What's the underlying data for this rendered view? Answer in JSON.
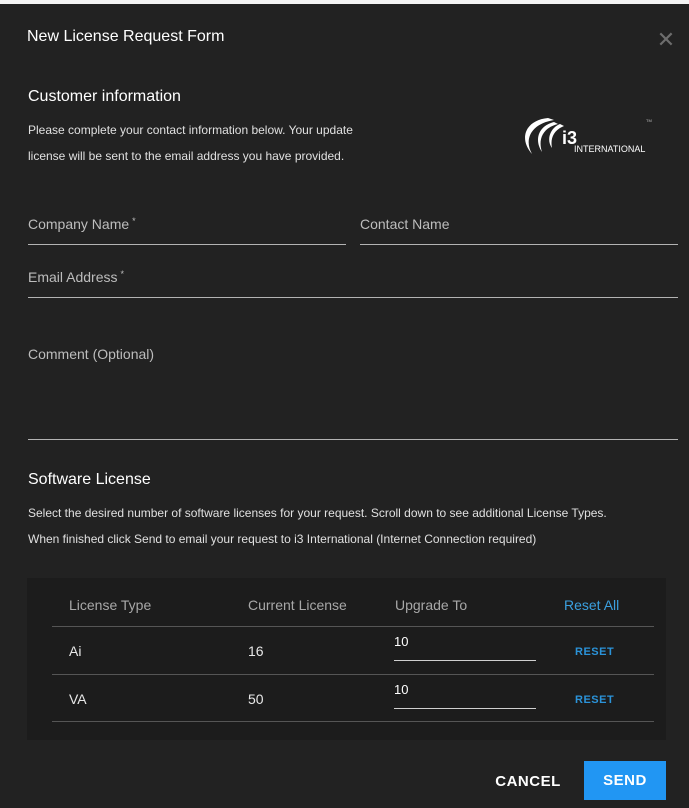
{
  "dialog": {
    "title": "New License Request Form",
    "close_icon": "close-icon"
  },
  "customer": {
    "heading": "Customer information",
    "desc_line1": "Please complete your contact information below. Your update",
    "desc_line2": "license will be sent to the email address you have provided.",
    "logo": {
      "mark": "i3",
      "text": "INTERNATIONAL",
      "tm": "TM"
    },
    "fields": {
      "company": {
        "label": "Company Name",
        "required": "*",
        "value": ""
      },
      "contact": {
        "label": "Contact Name",
        "value": ""
      },
      "email": {
        "label": "Email Address",
        "required": "*",
        "value": ""
      },
      "comment": {
        "label": "Comment (Optional)",
        "value": ""
      }
    }
  },
  "software": {
    "heading": "Software License",
    "desc_line1": "Select the desired number of software licenses for your request. Scroll down to see additional License Types.",
    "desc_line2": "When finished click Send to email your request to i3 International (Internet Connection required)",
    "table": {
      "headers": {
        "type": "License Type",
        "current": "Current License",
        "upgrade": "Upgrade To",
        "reset_all": "Reset All"
      },
      "rows": [
        {
          "type": "Ai",
          "current": "16",
          "upgrade": "10",
          "reset": "RESET"
        },
        {
          "type": "VA",
          "current": "50",
          "upgrade": "10",
          "reset": "RESET"
        }
      ]
    }
  },
  "actions": {
    "cancel": "CANCEL",
    "send": "SEND"
  },
  "colors": {
    "background": "#222222",
    "accent": "#2196f3",
    "link": "#3ba0df"
  }
}
